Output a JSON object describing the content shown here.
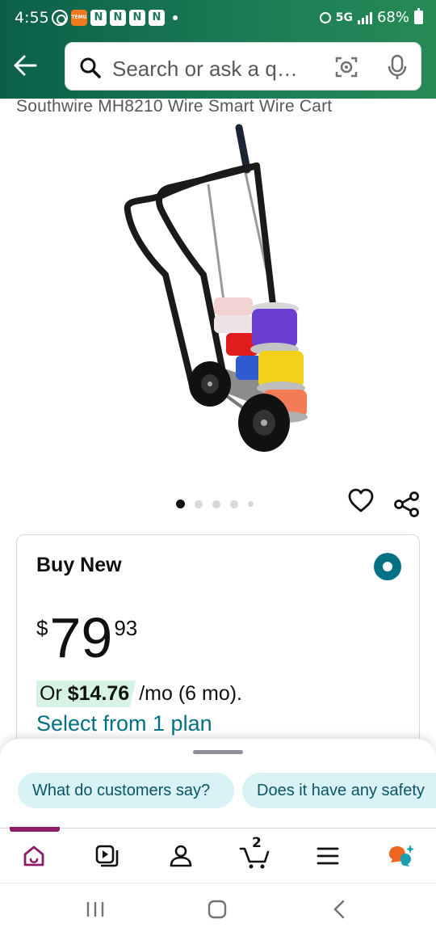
{
  "status_bar": {
    "time": "4:55",
    "network": "5G",
    "battery": "68%",
    "temu_label": "TEMU",
    "app_badge_letter": "N"
  },
  "header": {
    "back_icon": "arrow-left-icon",
    "search_placeholder": "Search or ask a q…",
    "camera_icon": "camera-lens-icon",
    "mic_icon": "microphone-icon"
  },
  "product": {
    "title": "Southwire MH8210 Wire Smart Wire Cart",
    "image_count": 5,
    "active_image": 1
  },
  "buy_box": {
    "title": "Buy New",
    "price_symbol": "$",
    "price_whole": "79",
    "price_fraction": "93",
    "monthly_or": "Or",
    "monthly_amount": "$14.76",
    "monthly_terms": "/mo (6 mo).",
    "select_plan": "Select from 1 plan"
  },
  "suggestions": [
    {
      "label": "What do customers say?"
    },
    {
      "label": "Does it have any safety"
    }
  ],
  "bottom_nav": {
    "items": [
      "home-icon",
      "video-icon",
      "account-icon",
      "cart-icon",
      "menu-icon",
      "rufus-icon"
    ],
    "cart_count": "2",
    "accent_color": "#8d1d6b"
  },
  "colors": {
    "header_green": "#1c7d56",
    "link_teal": "#007185",
    "chip_bg": "#d9f2f5",
    "highlight_green": "#d7f3e3"
  }
}
